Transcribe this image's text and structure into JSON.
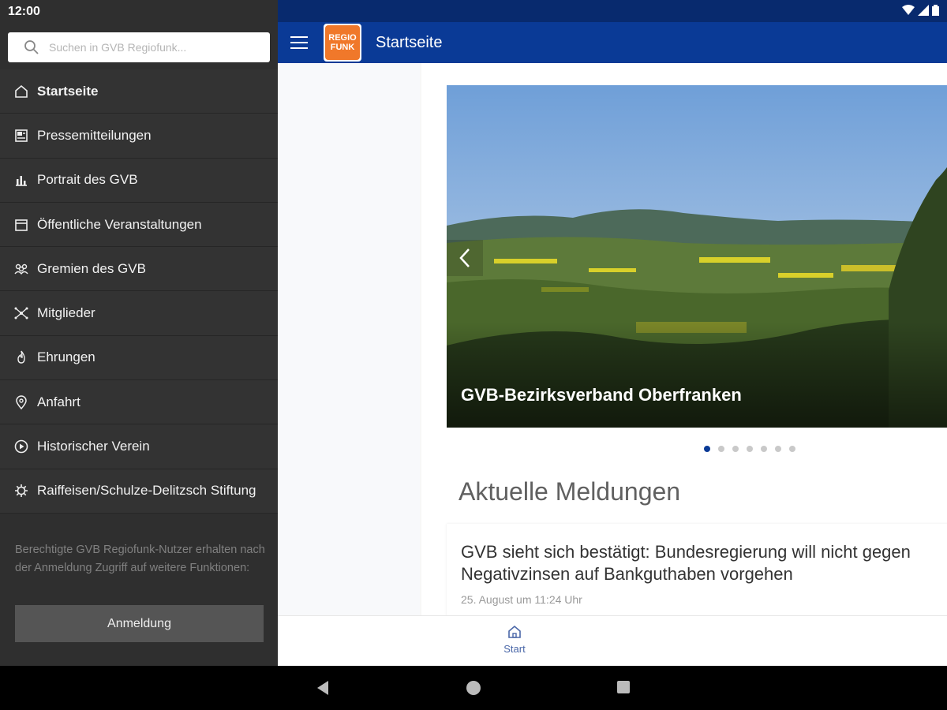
{
  "status": {
    "time": "12:00"
  },
  "drawer": {
    "search_placeholder": "Suchen in GVB Regiofunk...",
    "items": [
      {
        "label": "Startseite",
        "icon": "home-icon",
        "active": true
      },
      {
        "label": "Pressemitteilungen",
        "icon": "newspaper-icon"
      },
      {
        "label": "Portrait des GVB",
        "icon": "bar-chart-icon"
      },
      {
        "label": "Öffentliche Veranstaltungen",
        "icon": "calendar-icon"
      },
      {
        "label": "Gremien des GVB",
        "icon": "group-icon"
      },
      {
        "label": "Mitglieder",
        "icon": "network-icon"
      },
      {
        "label": "Ehrungen",
        "icon": "flame-icon"
      },
      {
        "label": "Anfahrt",
        "icon": "location-pin-icon"
      },
      {
        "label": "Historischer Verein",
        "icon": "play-circle-icon"
      },
      {
        "label": "Raiffeisen/Schulze-Delitzsch Stiftung",
        "icon": "gear-icon"
      }
    ],
    "login_hint": "Berechtigte GVB Regiofunk-Nutzer erhalten nach der Anmeldung Zugriff auf weitere Funktionen:",
    "login_button": "Anmeldung"
  },
  "appbar": {
    "title": "Startseite",
    "logo_top": "REGIO",
    "logo_bottom": "FUNK"
  },
  "carousel": {
    "caption": "GVB-Bezirksverband Oberfranken",
    "slide_count": 7,
    "active_index": 0
  },
  "news": {
    "section_title": "Aktuelle Meldungen",
    "items": [
      {
        "title": "GVB sieht sich bestätigt: Bundesregierung will nicht gegen Negativzinsen auf Bankguthaben vorgehen",
        "date": "25. August um 11:24 Uhr"
      }
    ]
  },
  "bottom_nav": {
    "label": "Start"
  },
  "colors": {
    "appbar": "#0a3a96",
    "statusbar": "#082a6e",
    "drawer_bg": "#333333",
    "accent": "#0a3a96",
    "logo_orange": "#f0782a"
  }
}
